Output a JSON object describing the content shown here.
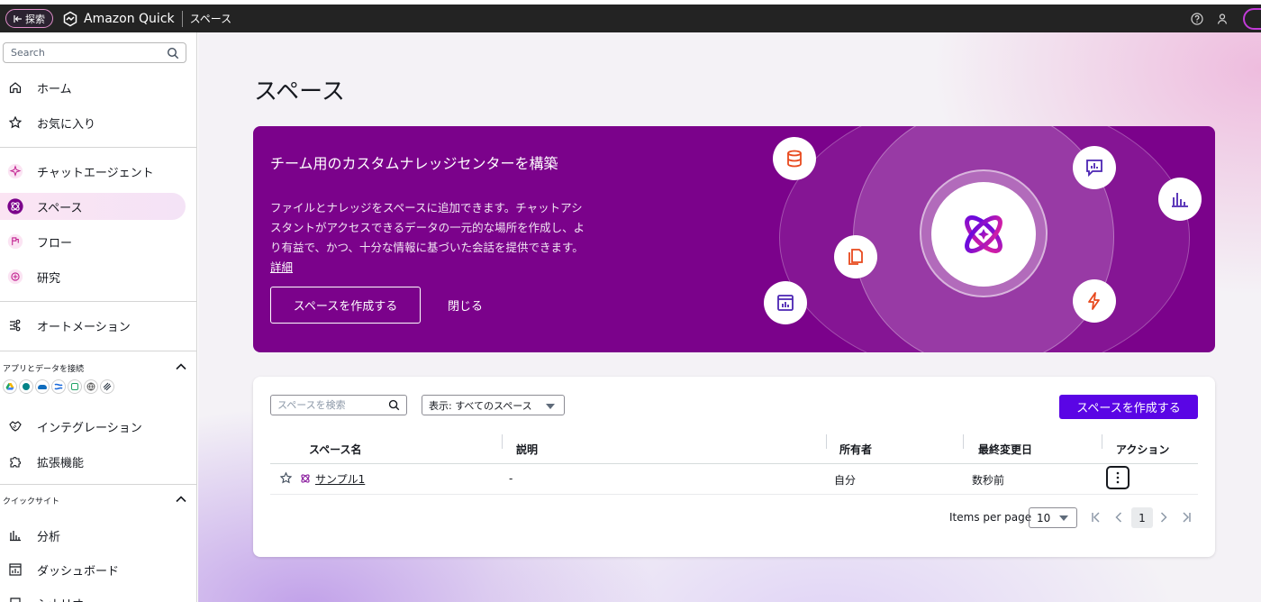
{
  "topbar": {
    "explore_label": "探索",
    "app_name": "Amazon Quick",
    "page": "スペース",
    "icons": [
      "help-icon",
      "user-icon"
    ]
  },
  "sidebar": {
    "search_placeholder": "Search",
    "items": [
      {
        "label": "ホーム",
        "icon": "home-icon"
      },
      {
        "label": "お気に入り",
        "icon": "star-icon"
      },
      {
        "label": "チャットエージェント",
        "icon": "sparkle-icon"
      },
      {
        "label": "スペース",
        "icon": "space-icon",
        "active": true
      },
      {
        "label": "フロー",
        "icon": "flow-icon"
      },
      {
        "label": "研究",
        "icon": "research-icon"
      },
      {
        "label": "オートメーション",
        "icon": "automation-icon"
      },
      {
        "label": "インテグレーション",
        "icon": "integration-icon"
      },
      {
        "label": "拡張機能",
        "icon": "puzzle-icon"
      },
      {
        "label": "分析",
        "icon": "analysis-icon"
      },
      {
        "label": "ダッシュボード",
        "icon": "dashboard-icon"
      },
      {
        "label": "シナリオ",
        "icon": "scenario-icon"
      }
    ],
    "sections": {
      "apps": "アプリとデータを接続",
      "quicksight": "クイックサイト"
    },
    "app_connectors": [
      "google-drive-icon",
      "sharepoint-icon",
      "onedrive-icon",
      "confluence-icon",
      "excel-icon",
      "web-icon",
      "s3-icon"
    ]
  },
  "main": {
    "title": "スペース",
    "hero": {
      "title": "チーム用のカスタムナレッジセンターを構築",
      "description": "ファイルとナレッジをスペースに追加できます。チャットアシスタントがアクセスできるデータの一元的な場所を作成し、より有益で、かつ、十分な情報に基づいた会話を提供できます。",
      "link": "詳細",
      "primary_button": "スペースを作成する",
      "close_button": "閉じる"
    },
    "table": {
      "search_placeholder": "スペースを検索",
      "filter_value": "表示: すべてのスペース",
      "create_button": "スペースを作成する",
      "columns": [
        "スペース名",
        "説明",
        "所有者",
        "最終変更日",
        "アクション"
      ],
      "rows": [
        {
          "name": "サンプル1",
          "description": "-",
          "owner": "自分",
          "modified": "数秒前"
        }
      ],
      "pagination": {
        "items_per_page_label": "Items per page",
        "items_per_page": "10",
        "current_page": "1"
      }
    }
  },
  "colors": {
    "hero_bg": "#7b028b",
    "primary_button": "#5a05e5",
    "accent_pink": "#e0219e"
  }
}
